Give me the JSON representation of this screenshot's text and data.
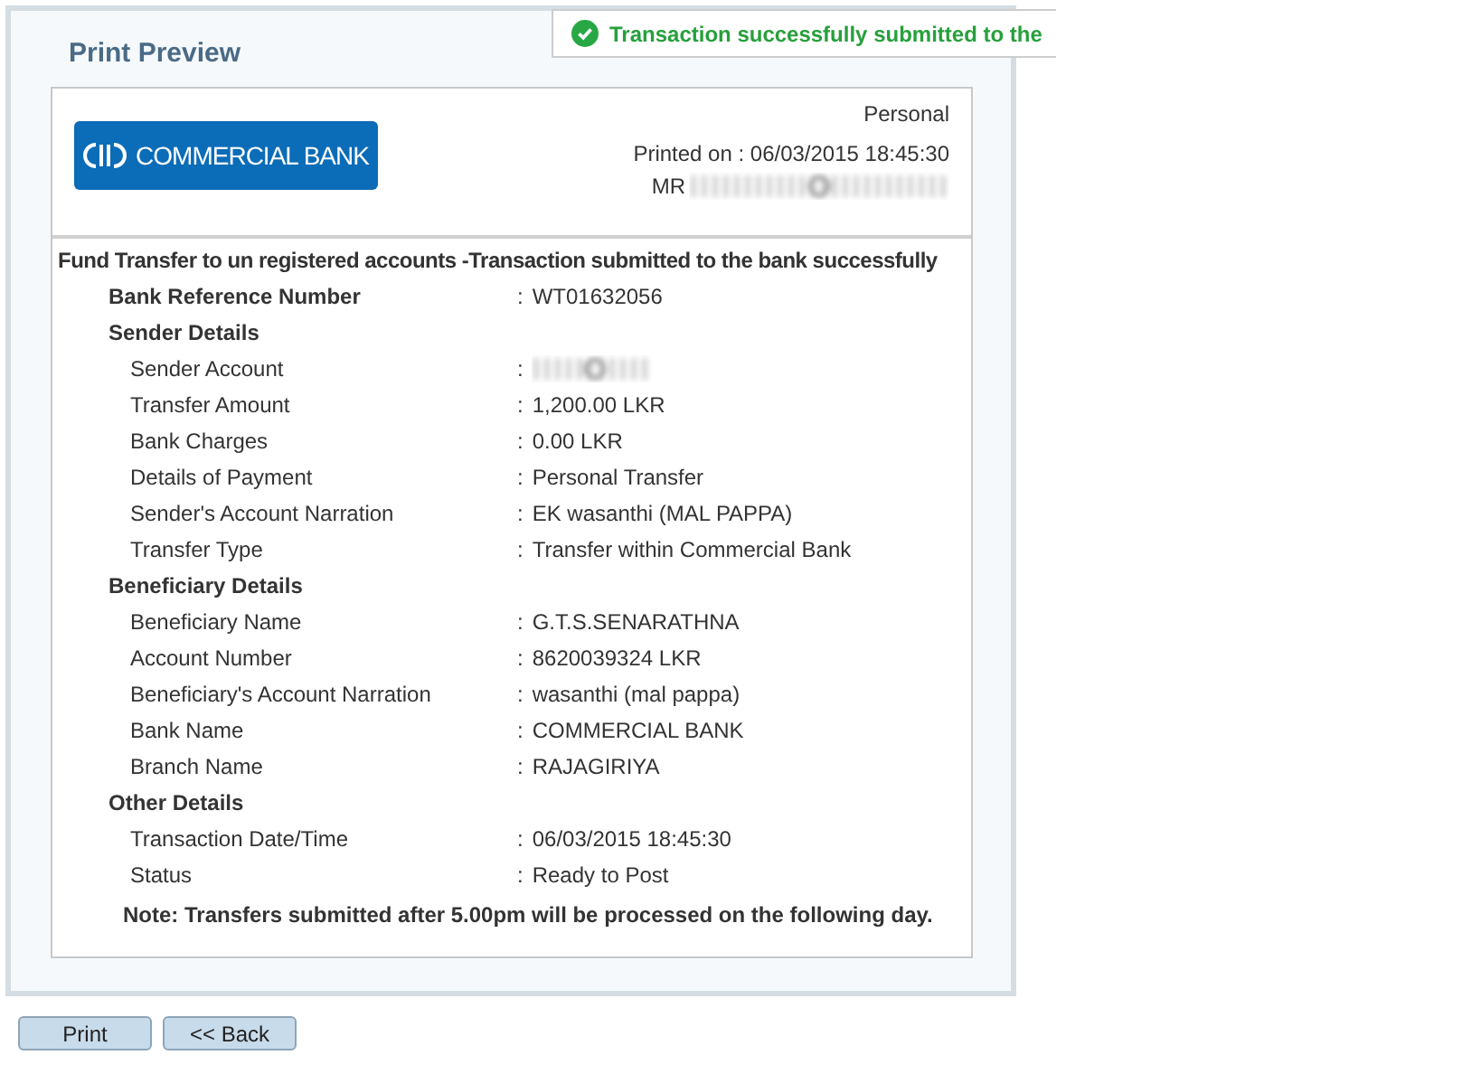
{
  "title": "Print Preview",
  "toast": {
    "text": "Transaction successfully submitted to the"
  },
  "separator": ":",
  "header": {
    "logo_text": "COMMERCIAL BANK",
    "account_type": "Personal",
    "printed_on": "Printed on : 06/03/2015 18:45:30",
    "customer_prefix": "MR"
  },
  "heading": "Fund Transfer to un registered accounts -Transaction submitted to the bank successfully",
  "rows": [
    {
      "kind": "key",
      "label": "Bank Reference Number",
      "value": "WT01632056"
    },
    {
      "kind": "section",
      "label": "Sender Details"
    },
    {
      "kind": "redacted",
      "label": "Sender Account"
    },
    {
      "kind": "field",
      "label": "Transfer Amount",
      "value": "1,200.00 LKR"
    },
    {
      "kind": "field",
      "label": "Bank Charges",
      "value": "0.00 LKR"
    },
    {
      "kind": "field",
      "label": "Details of Payment",
      "value": "Personal Transfer"
    },
    {
      "kind": "field",
      "label": "Sender's Account Narration",
      "value": "EK wasanthi (MAL PAPPA)"
    },
    {
      "kind": "field",
      "label": "Transfer Type",
      "value": "Transfer within Commercial Bank"
    },
    {
      "kind": "section",
      "label": "Beneficiary Details"
    },
    {
      "kind": "field",
      "label": "Beneficiary Name",
      "value": "G.T.S.SENARATHNA"
    },
    {
      "kind": "field",
      "label": "Account Number",
      "value": "8620039324 LKR"
    },
    {
      "kind": "field",
      "label": "Beneficiary's Account Narration",
      "value": "wasanthi (mal pappa)"
    },
    {
      "kind": "field",
      "label": "Bank Name",
      "value": "COMMERCIAL BANK"
    },
    {
      "kind": "field",
      "label": "Branch Name",
      "value": "RAJAGIRIYA"
    },
    {
      "kind": "section",
      "label": "Other Details"
    },
    {
      "kind": "field",
      "label": "Transaction Date/Time",
      "value": "06/03/2015 18:45:30"
    },
    {
      "kind": "field",
      "label": "Status",
      "value": "Ready to Post"
    }
  ],
  "note": "Note: Transfers submitted after 5.00pm will be processed on the following day.",
  "buttons": [
    "Print",
    "<< Back"
  ]
}
